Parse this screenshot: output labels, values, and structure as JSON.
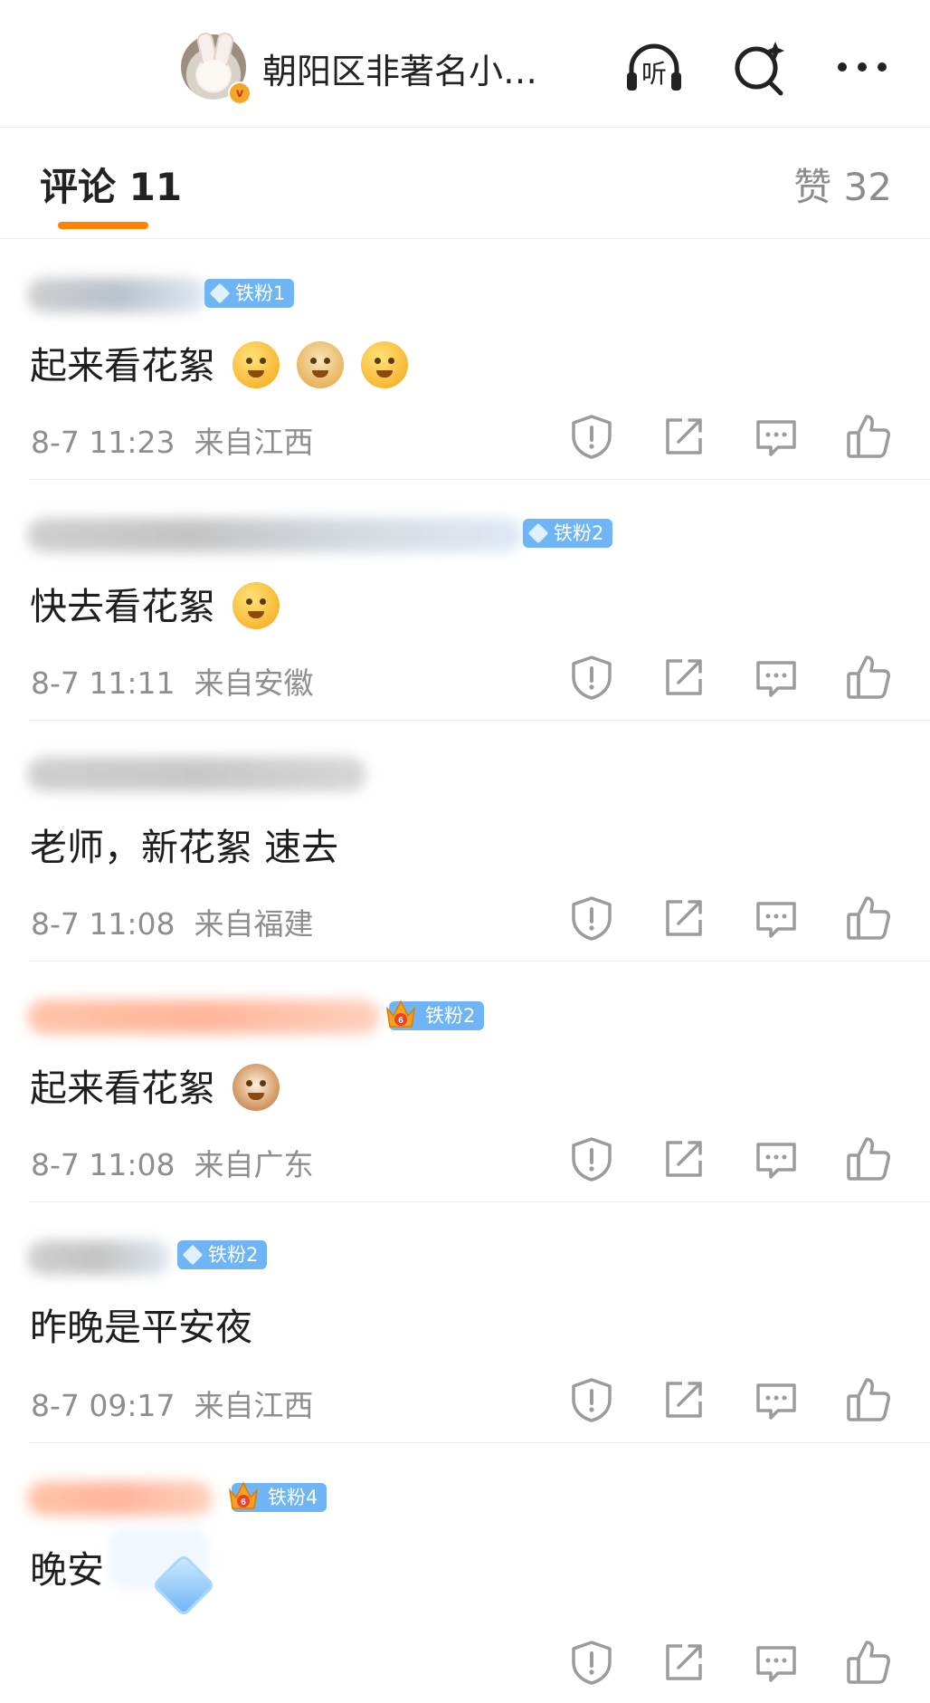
{
  "header": {
    "account_name": "朝阳区非著名小…",
    "listen_label": "听",
    "avatar_badge": "v"
  },
  "tabs": {
    "comments_label": "评论 11",
    "likes_label": "赞 32",
    "accent_color": "#ff8200"
  },
  "comments": [
    {
      "badge": "铁粉1",
      "badge_type": "diamond",
      "text": "起来看花絮",
      "emojis": [
        "thinking-face",
        "doge-face",
        "laughing-face"
      ],
      "time": "8-7 11:23",
      "location": "来自江西"
    },
    {
      "badge": "铁粉2",
      "badge_type": "diamond",
      "text": "快去看花絮",
      "emojis": [
        "crying-face"
      ],
      "time": "8-7 11:11",
      "location": "来自安徽"
    },
    {
      "badge": "",
      "badge_type": "none",
      "text": "老师，新花絮 速去",
      "emojis": [],
      "time": "8-7 11:08",
      "location": "来自福建"
    },
    {
      "badge": "铁粉2",
      "badge_type": "crown",
      "text": "起来看花絮",
      "emojis": [
        "cat-face"
      ],
      "time": "8-7 11:08",
      "location": "来自广东"
    },
    {
      "badge": "铁粉2",
      "badge_type": "diamond",
      "text": "昨晚是平安夜",
      "emojis": [],
      "time": "8-7 09:17",
      "location": "来自江西"
    },
    {
      "badge": "铁粉4",
      "badge_type": "crown",
      "text": "晚安",
      "emojis": [],
      "time": "",
      "location": ""
    }
  ],
  "comment_actions": [
    "report-icon",
    "repost-icon",
    "reply-icon",
    "like-icon"
  ],
  "colors": {
    "badge_blue": "#6fb5f5",
    "meta_gray": "#8e8e8e",
    "icon_gray": "#9b9b9b"
  }
}
